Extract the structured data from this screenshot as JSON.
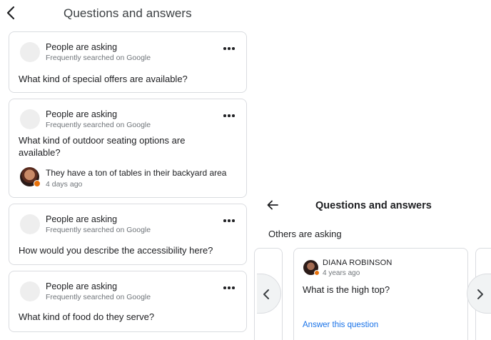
{
  "left_panel": {
    "title": "Questions and answers",
    "icons": {
      "back": "chevron-left-icon",
      "more": "more-horizontal-icon"
    },
    "cards": [
      {
        "asking_label": "People are asking",
        "source": "Frequently searched on Google",
        "question": "What kind of special offers are available?"
      },
      {
        "asking_label": "People are asking",
        "source": "Frequently searched on Google",
        "question": "What kind of outdoor seating options are available?",
        "answer": {
          "text": "They have a ton of tables in their backyard area",
          "time": "4 days ago"
        }
      },
      {
        "asking_label": "People are asking",
        "source": "Frequently searched on Google",
        "question": "How would you describe the accessibility here?"
      },
      {
        "asking_label": "People are asking",
        "source": "Frequently searched on Google",
        "question": "What kind of food do they serve?"
      }
    ]
  },
  "right_panel": {
    "title": "Questions and answers",
    "section_label": "Others are asking",
    "icons": {
      "back": "arrow-left-icon",
      "prev": "chevron-left-icon",
      "next": "chevron-right-icon"
    },
    "card": {
      "author": "DIANA ROBINSON",
      "time": "4 years ago",
      "question": "What is the high top?",
      "answer_link": "Answer this question"
    }
  },
  "colors": {
    "link": "#1a73e8",
    "secondary_text": "#70757a",
    "border": "#dadce0",
    "local_guide_badge": "#e8710a"
  }
}
